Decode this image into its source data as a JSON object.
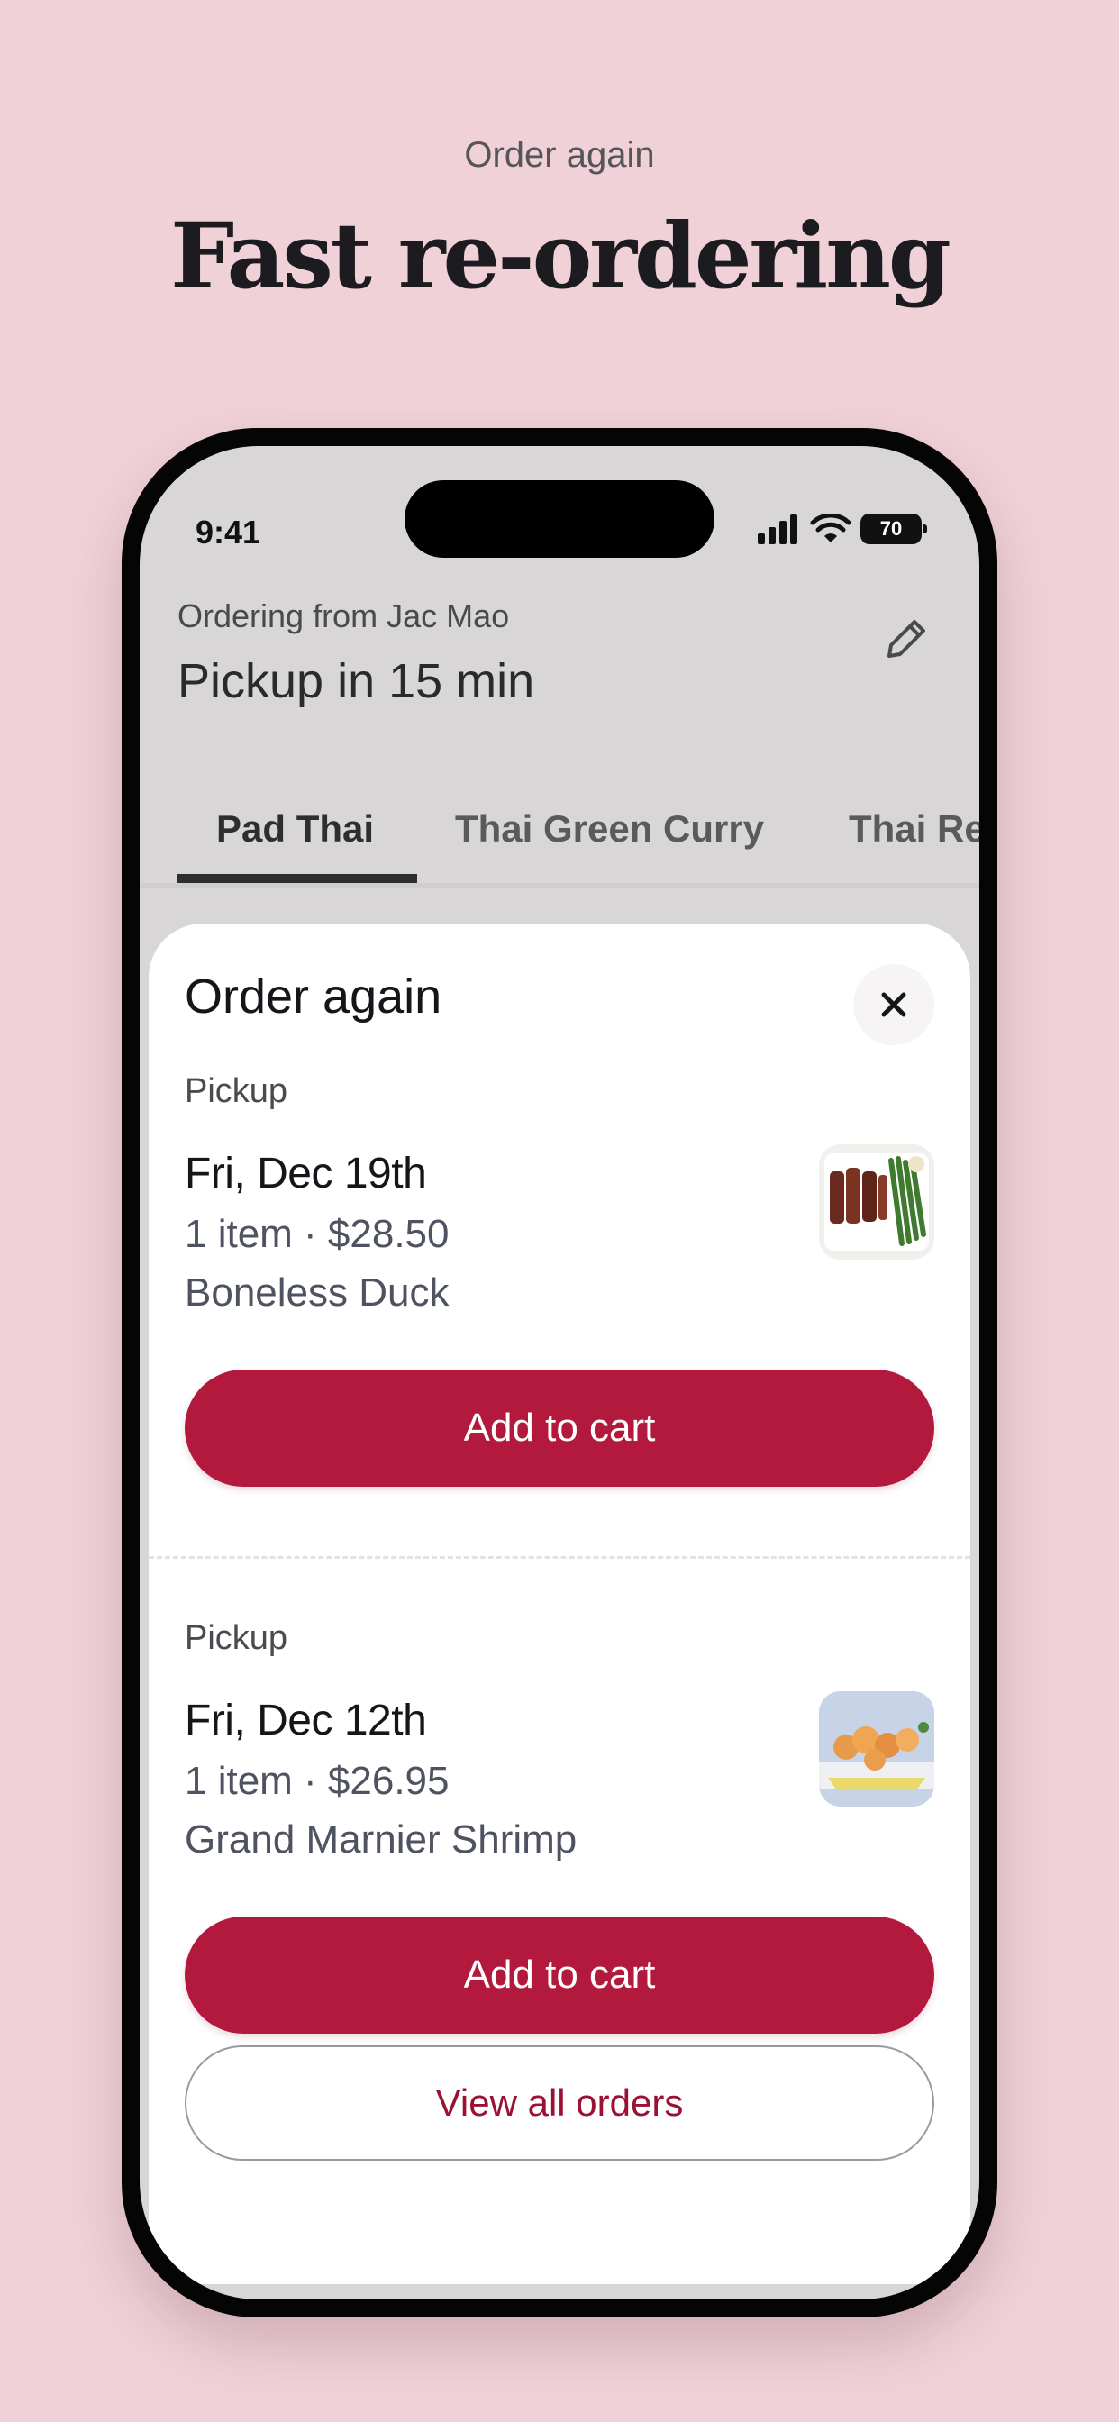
{
  "promo": {
    "subtitle": "Order again",
    "title": "Fast re-ordering"
  },
  "status_bar": {
    "time": "9:41",
    "battery": "70"
  },
  "header": {
    "ordering_from": "Ordering from Jac Mao",
    "pickup_time": "Pickup in 15 min",
    "edit_icon": "pencil-icon"
  },
  "tabs": [
    {
      "label": "Pad Thai",
      "active": true
    },
    {
      "label": "Thai Green Curry",
      "active": false
    },
    {
      "label": "Thai Re",
      "active": false
    }
  ],
  "sheet": {
    "title": "Order again",
    "close_icon": "close-icon",
    "orders": [
      {
        "type": "Pickup",
        "date": "Fri, Dec 19th",
        "summary": "1 item · $28.50",
        "item": "Boneless Duck",
        "button": "Add to cart"
      },
      {
        "type": "Pickup",
        "date": "Fri, Dec 12th",
        "summary": "1 item · $26.95",
        "item": "Grand Marnier Shrimp",
        "button": "Add to cart"
      }
    ],
    "view_all": "View all orders"
  },
  "colors": {
    "background": "#efd1d7",
    "accent": "#b3193c",
    "accent_text": "#9b1133"
  }
}
